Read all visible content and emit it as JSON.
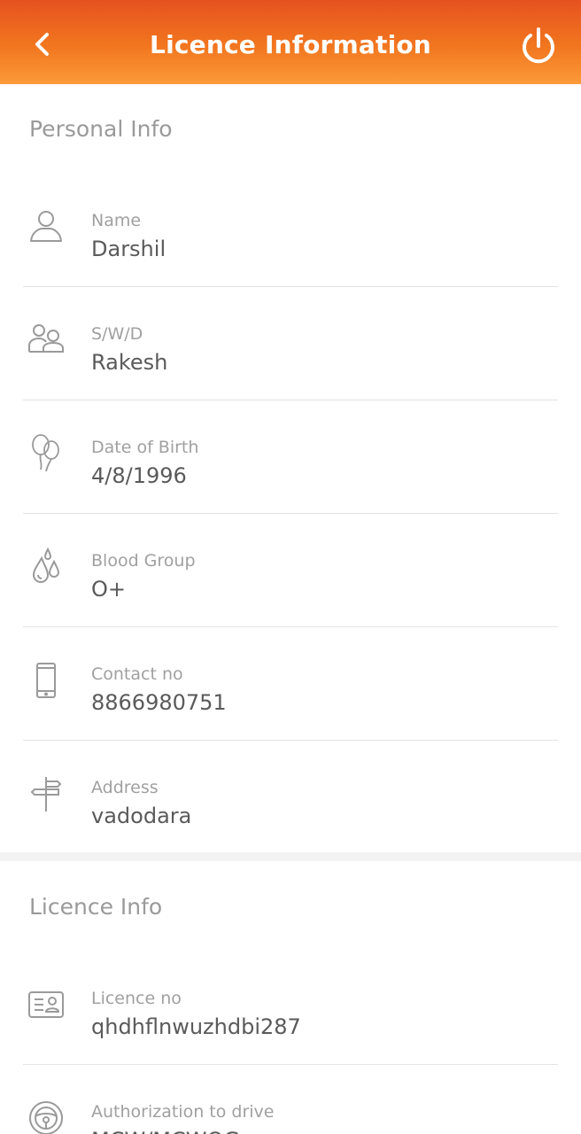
{
  "header": {
    "title": "Licence Information",
    "back_icon": "chevron-left-icon",
    "power_icon": "power-icon",
    "gradient_colors": [
      "#e6521f",
      "#fb9a39"
    ]
  },
  "personal_info": {
    "title": "Personal Info",
    "fields": [
      {
        "icon": "person-icon",
        "label": "Name",
        "value": "Darshil"
      },
      {
        "icon": "people-icon",
        "label": "S/W/D",
        "value": "Rakesh"
      },
      {
        "icon": "balloons-icon",
        "label": "Date of Birth",
        "value": "4/8/1996"
      },
      {
        "icon": "blood-drops-icon",
        "label": "Blood Group",
        "value": "O+"
      },
      {
        "icon": "phone-icon",
        "label": "Contact no",
        "value": "8866980751"
      },
      {
        "icon": "signpost-icon",
        "label": "Address",
        "value": "vadodara"
      }
    ]
  },
  "licence_info": {
    "title": "Licence Info",
    "fields": [
      {
        "icon": "id-card-icon",
        "label": "Licence no",
        "value": "qhdhflnwuzhdbi287"
      },
      {
        "icon": "steering-wheel-icon",
        "label": "Authorization to drive",
        "value": "MCW/MCWOG"
      }
    ]
  }
}
